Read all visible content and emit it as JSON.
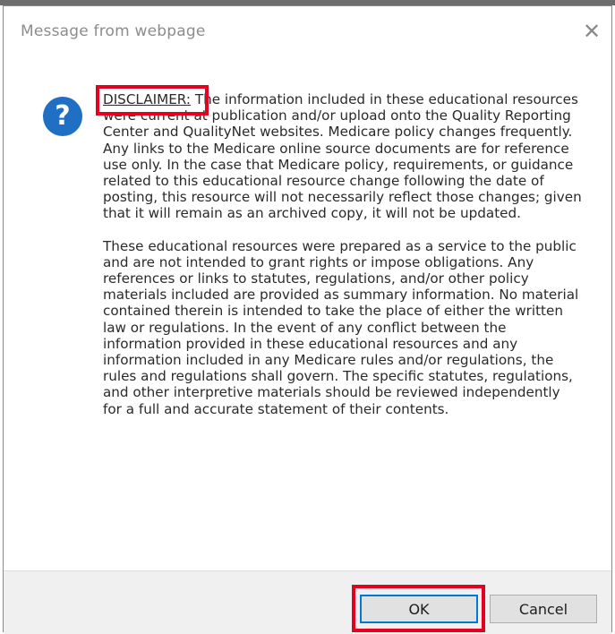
{
  "dialog": {
    "title": "Message from webpage",
    "close_glyph": "✕",
    "icon": "question-icon",
    "disclaimer_label": "DISCLAIMER:",
    "paragraph1_rest": " The information included in these educational resources were current at publication and/or upload onto the Quality Reporting Center and QualityNet websites. Medicare policy changes frequently. Any links to the Medicare online source documents are for reference use only. In the case that Medicare policy, requirements, or guidance related to this educational resource change following the date of posting, this resource will not necessarily reflect those changes; given that it will remain as an archived copy, it will not be updated.",
    "paragraph2": "These educational resources were prepared as a service to the public and are not intended to grant rights or impose obligations. Any references or links to statutes, regulations, and/or other policy materials included are provided as summary information. No material contained therein is intended to take the place of either the written law or regulations. In the event of any conflict between the information provided in these educational resources and any information included in any Medicare rules and/or regulations, the rules and regulations shall govern. The specific statutes, regulations, and other interpretive materials should be reviewed independently for a full and accurate statement of their contents."
  },
  "buttons": {
    "ok_label": "OK",
    "cancel_label": "Cancel"
  },
  "colors": {
    "highlight": "#e4001e",
    "icon_blue": "#1f6fc4",
    "focus_border": "#0078d7"
  }
}
